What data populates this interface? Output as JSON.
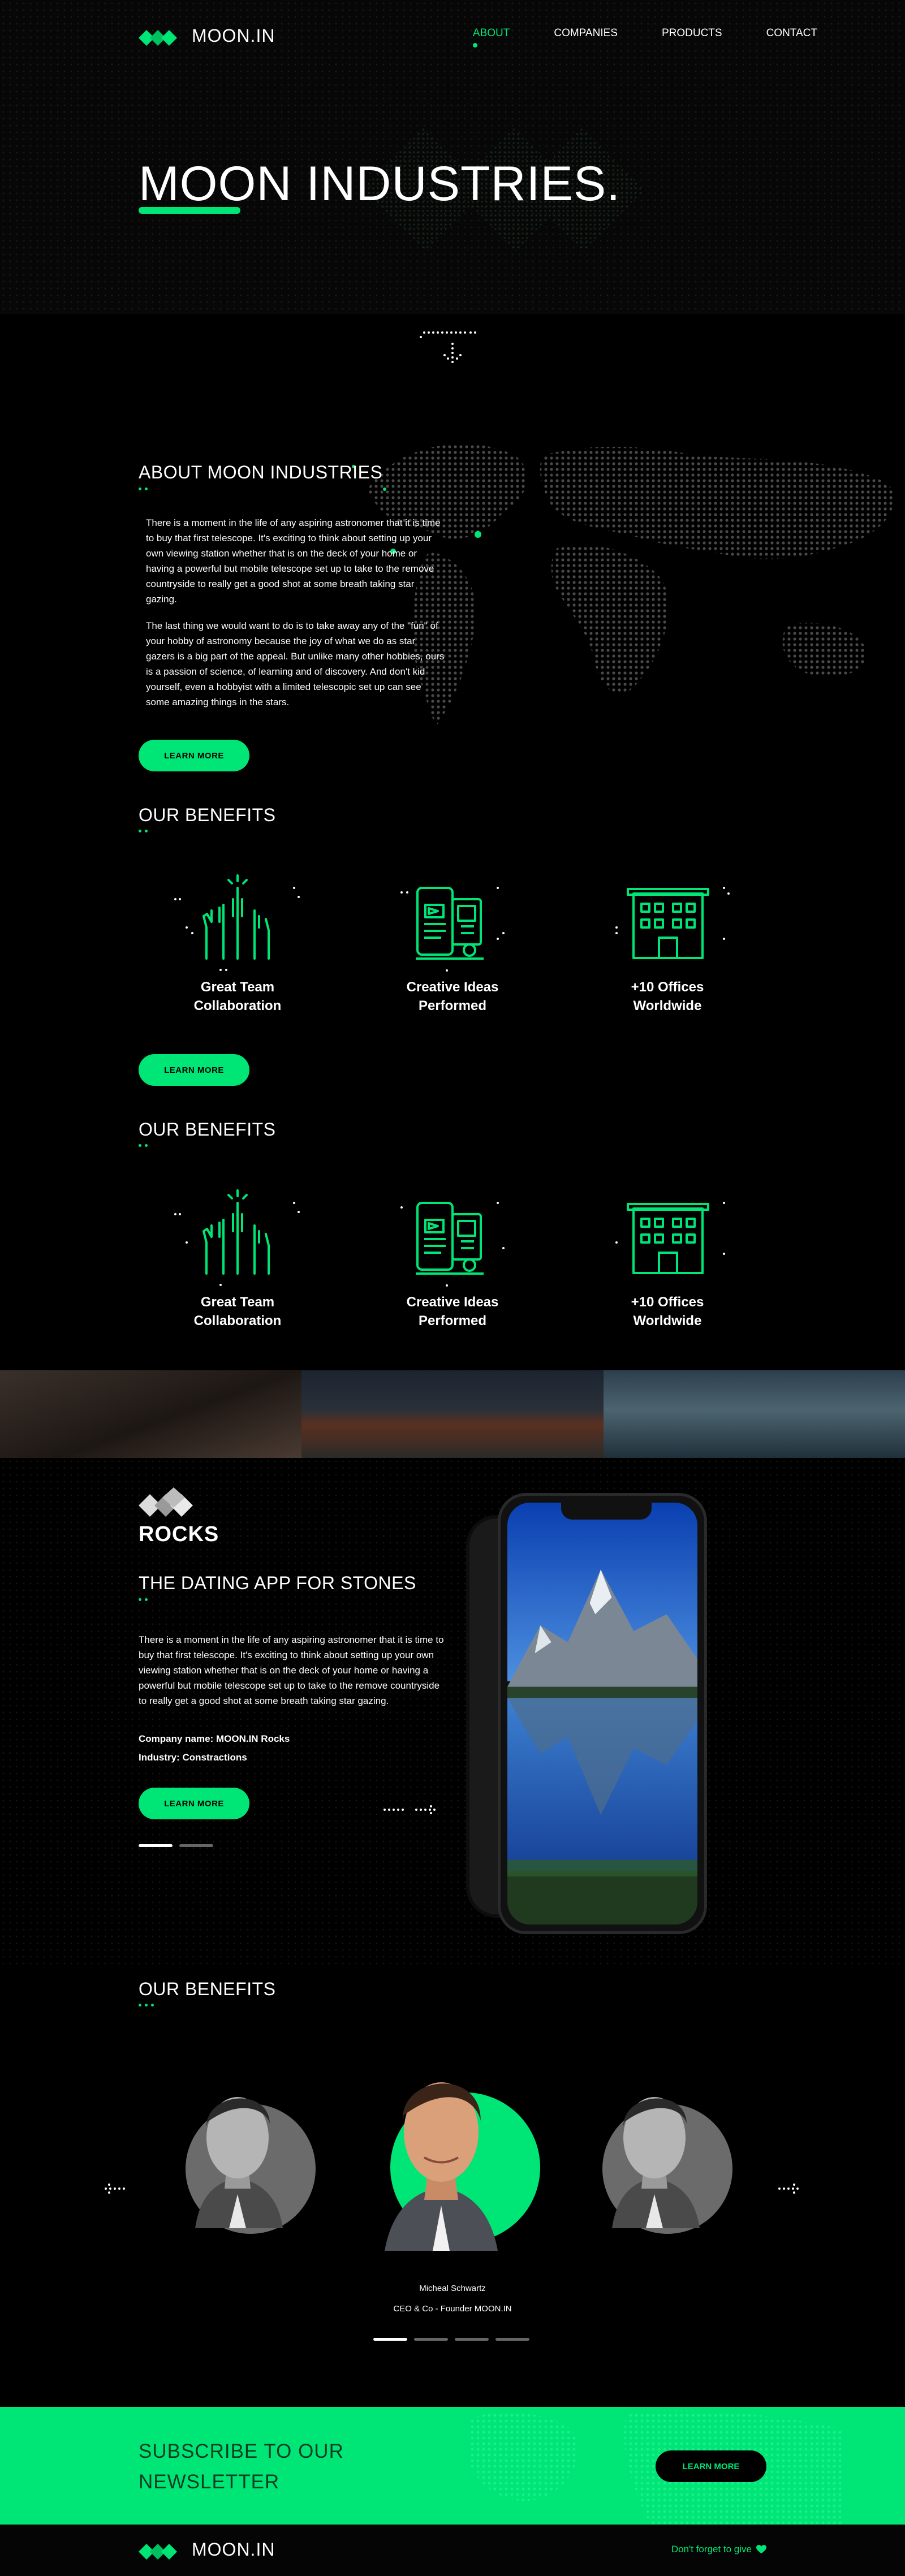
{
  "brand": {
    "name": "MOON.IN",
    "accent": "#00e676"
  },
  "nav": [
    {
      "label": "ABOUT",
      "active": true
    },
    {
      "label": "COMPANIES",
      "active": false
    },
    {
      "label": "PRODUCTS",
      "active": false
    },
    {
      "label": "CONTACT",
      "active": false
    }
  ],
  "hero": {
    "title": "MOON INDUSTRIES."
  },
  "about": {
    "title": "ABOUT MOON INDUSTRIES",
    "para1": "There is a moment in the life of any aspiring astronomer that it is time to buy that first telescope. It's exciting to think about setting up your own viewing station whether that is on the deck of your home or having a powerful but mobile telescope set up to take to the remove countryside to really get a good shot at some breath taking star gazing.",
    "para2": "The last thing we would want to do is to take away any of the \"fun\" of your hobby of astronomy because the joy of what we do as star gazers is a big part of the appeal. But unlike many other hobbies, ours is a passion of science, of learning and of discovery. And don't kid yourself, even a hobbyist with a limited telescopic set up can see some amazing things in the stars.",
    "button": "LEARN MORE"
  },
  "benefits1": {
    "title": "OUR BENEFITS",
    "items": [
      {
        "label_line1": "Great Team",
        "label_line2": "Collaboration",
        "icon": "hands-raised-icon"
      },
      {
        "label_line1": "Creative Ideas",
        "label_line2": "Performed",
        "icon": "devices-ideas-icon"
      },
      {
        "label_line1": "+10 Offices",
        "label_line2": "Worldwide",
        "icon": "office-building-icon"
      }
    ],
    "button": "LEARN MORE"
  },
  "benefits2": {
    "title": "OUR BENEFITS",
    "items": [
      {
        "label_line1": "Great Team",
        "label_line2": "Collaboration",
        "icon": "hands-raised-icon"
      },
      {
        "label_line1": "Creative Ideas",
        "label_line2": "Performed",
        "icon": "devices-ideas-icon"
      },
      {
        "label_line1": "+10 Offices",
        "label_line2": "Worldwide",
        "icon": "office-building-icon"
      }
    ]
  },
  "rocks": {
    "logo_word": "ROCKS",
    "title": "THE DATING APP FOR STONES",
    "para": "There is a moment in the life of any aspiring astronomer that it is time to buy that first telescope. It's exciting to think about setting up your own viewing station whether that is on the deck of your home or having a powerful but mobile telescope set up to take to the remove countryside to really get a good shot at some breath taking star gazing.",
    "company": "Company name: MOON.IN Rocks",
    "industry": "Industry: Constractions",
    "button": "LEARN MORE"
  },
  "team": {
    "title": "OUR BENEFITS",
    "name": "Micheal Schwartz",
    "role": "CEO & Co - Founder MOON.IN"
  },
  "newsletter": {
    "title_line1": "SUBSCRIBE TO OUR",
    "title_line2": "NEWSLETTER",
    "button": "LEARN MORE"
  },
  "footer": {
    "brand": "MOON.IN",
    "note": "Don't forget to give"
  }
}
